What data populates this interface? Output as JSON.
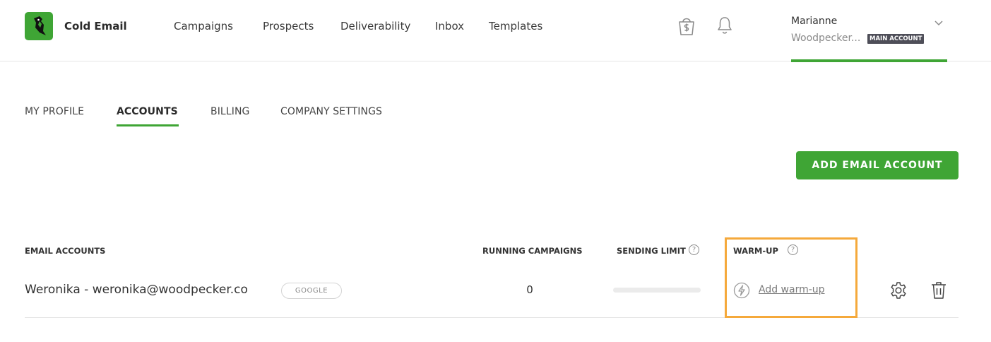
{
  "app": {
    "brand": "Cold Email",
    "accent_color": "#3fa535",
    "logo_icon": "woodpecker-logo-icon"
  },
  "nav": {
    "items": [
      "Campaigns",
      "Prospects",
      "Deliverability",
      "Inbox",
      "Templates"
    ],
    "shop_icon": "shopping-bag-dollar-icon",
    "bell_icon": "bell-icon"
  },
  "user": {
    "name": "Marianne",
    "org": "Woodpecker...",
    "badge": "MAIN ACCOUNT",
    "chevron_icon": "chevron-down-icon"
  },
  "tabs": {
    "items": [
      "MY PROFILE",
      "ACCOUNTS",
      "BILLING",
      "COMPANY SETTINGS"
    ],
    "active": "ACCOUNTS"
  },
  "actions": {
    "add_email_account": "ADD EMAIL ACCOUNT"
  },
  "table": {
    "headers": {
      "email_accounts": "EMAIL ACCOUNTS",
      "running_campaigns": "RUNNING CAMPAIGNS",
      "sending_limit": "SENDING LIMIT",
      "warm_up": "WARM-UP"
    },
    "help_glyph": "?",
    "rows": [
      {
        "account": "Weronika - weronika@woodpecker.co",
        "provider": "GOOGLE",
        "running_campaigns": "0",
        "sending_limit_progress": 0,
        "warm_up_link": "Add warm-up",
        "warm_up_icon": "lightning-bolt-icon",
        "settings_icon": "gear-icon",
        "delete_icon": "trash-icon"
      }
    ],
    "highlight_color": "#f5a93b"
  }
}
